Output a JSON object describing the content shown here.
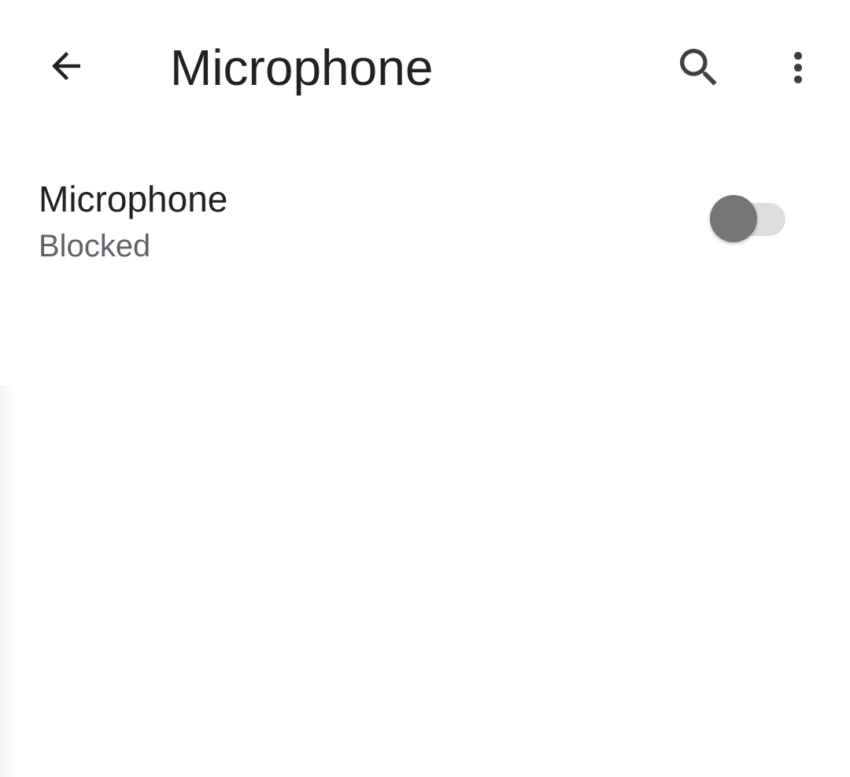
{
  "appbar": {
    "title": "Microphone",
    "back_icon": "arrow-back-icon",
    "search_icon": "search-icon",
    "more_icon": "more-vert-icon"
  },
  "setting": {
    "title": "Microphone",
    "summary": "Blocked",
    "toggle_on": false
  },
  "colors": {
    "text_primary": "#202124",
    "text_secondary": "#5f6368",
    "switch_thumb_off": "#757575",
    "switch_track_off": "#dedede"
  }
}
